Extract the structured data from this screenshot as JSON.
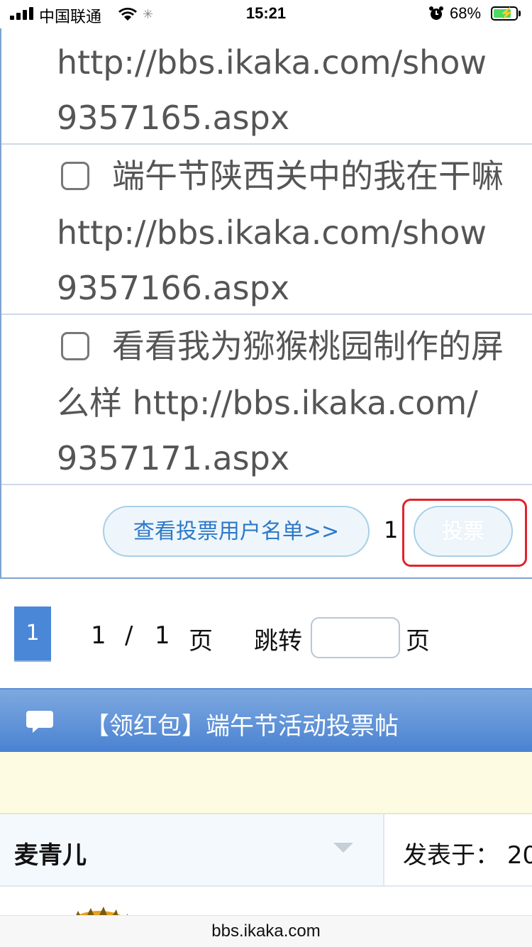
{
  "status_bar": {
    "carrier": "中国联通",
    "time": "15:21",
    "battery": "68%"
  },
  "poll": {
    "items": [
      {
        "lines": [
          "http://bbs.ikaka.com/show",
          "9357165.aspx"
        ]
      },
      {
        "lines": [
          "端午节陕西关中的我在干嘛",
          "http://bbs.ikaka.com/show",
          "9357166.aspx"
        ]
      },
      {
        "lines": [
          "看看我为猕猴桃园制作的屏",
          "么样 http://bbs.ikaka.com/",
          "9357171.aspx"
        ]
      }
    ],
    "view_voters_label": "查看投票用户名单>>",
    "vote_count": "1",
    "vote_button_label": "投票"
  },
  "pagination": {
    "current_page": "1",
    "page_info_current": "1",
    "page_info_sep": "/",
    "page_info_total": "1",
    "page_info_unit": "页",
    "jump_label": "跳转",
    "jump_unit": "页"
  },
  "post": {
    "title": "【领红包】端午节活动投票帖",
    "author": "麦青儿",
    "posted_prefix": "发表于：",
    "posted_value": "20"
  },
  "browser": {
    "url": "bbs.ikaka.com"
  },
  "colors": {
    "accent": "#4a87d6",
    "highlight": "#e0242c",
    "link": "#2e79c8"
  }
}
